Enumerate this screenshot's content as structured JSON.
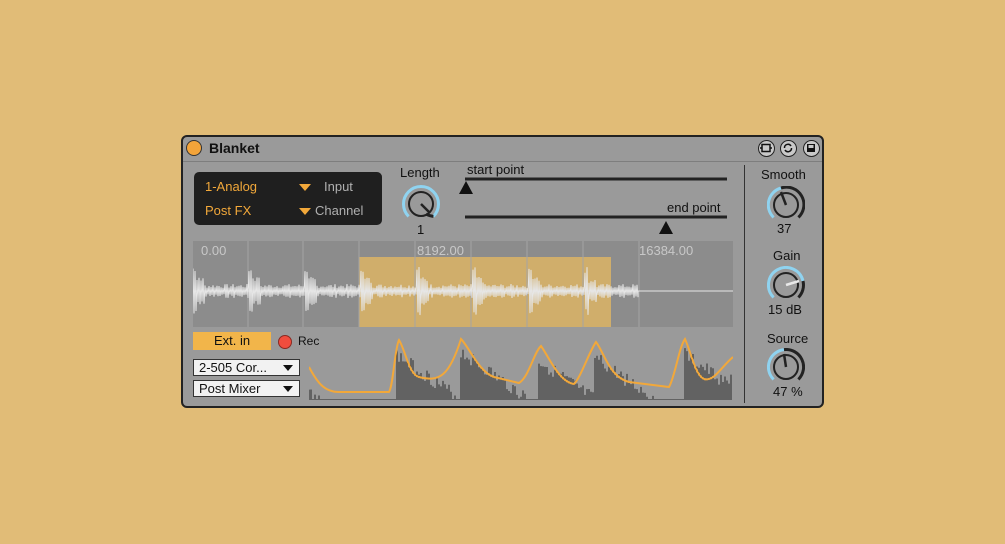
{
  "device": {
    "title": "Blanket",
    "routing": {
      "input_value": "1-Analog",
      "input_label": "Input",
      "channel_value": "Post FX",
      "channel_label": "Channel"
    },
    "length": {
      "label": "Length",
      "value": "1"
    },
    "start_point": {
      "label": "start point"
    },
    "end_point": {
      "label": "end point"
    },
    "waveform": {
      "markers": [
        "0.00",
        "8192.00",
        "16384.00"
      ]
    },
    "sidechain": {
      "ext_in_label": "Ext. in",
      "rec_label": "Rec",
      "source_dropdown": "2-505 Cor...",
      "tap_dropdown": "Post Mixer"
    },
    "smooth": {
      "label": "Smooth",
      "value": "37",
      "level": 0.37
    },
    "gain": {
      "label": "Gain",
      "value": "15 dB"
    },
    "source": {
      "label": "Source",
      "value": "47 %",
      "level": 0.47
    }
  },
  "colors": {
    "background": "#E1BC77",
    "panel": "#9A9A9A",
    "accent": "#F2A83A",
    "knob_arc": "#8FD3F0",
    "rec": "#F04D3E"
  }
}
